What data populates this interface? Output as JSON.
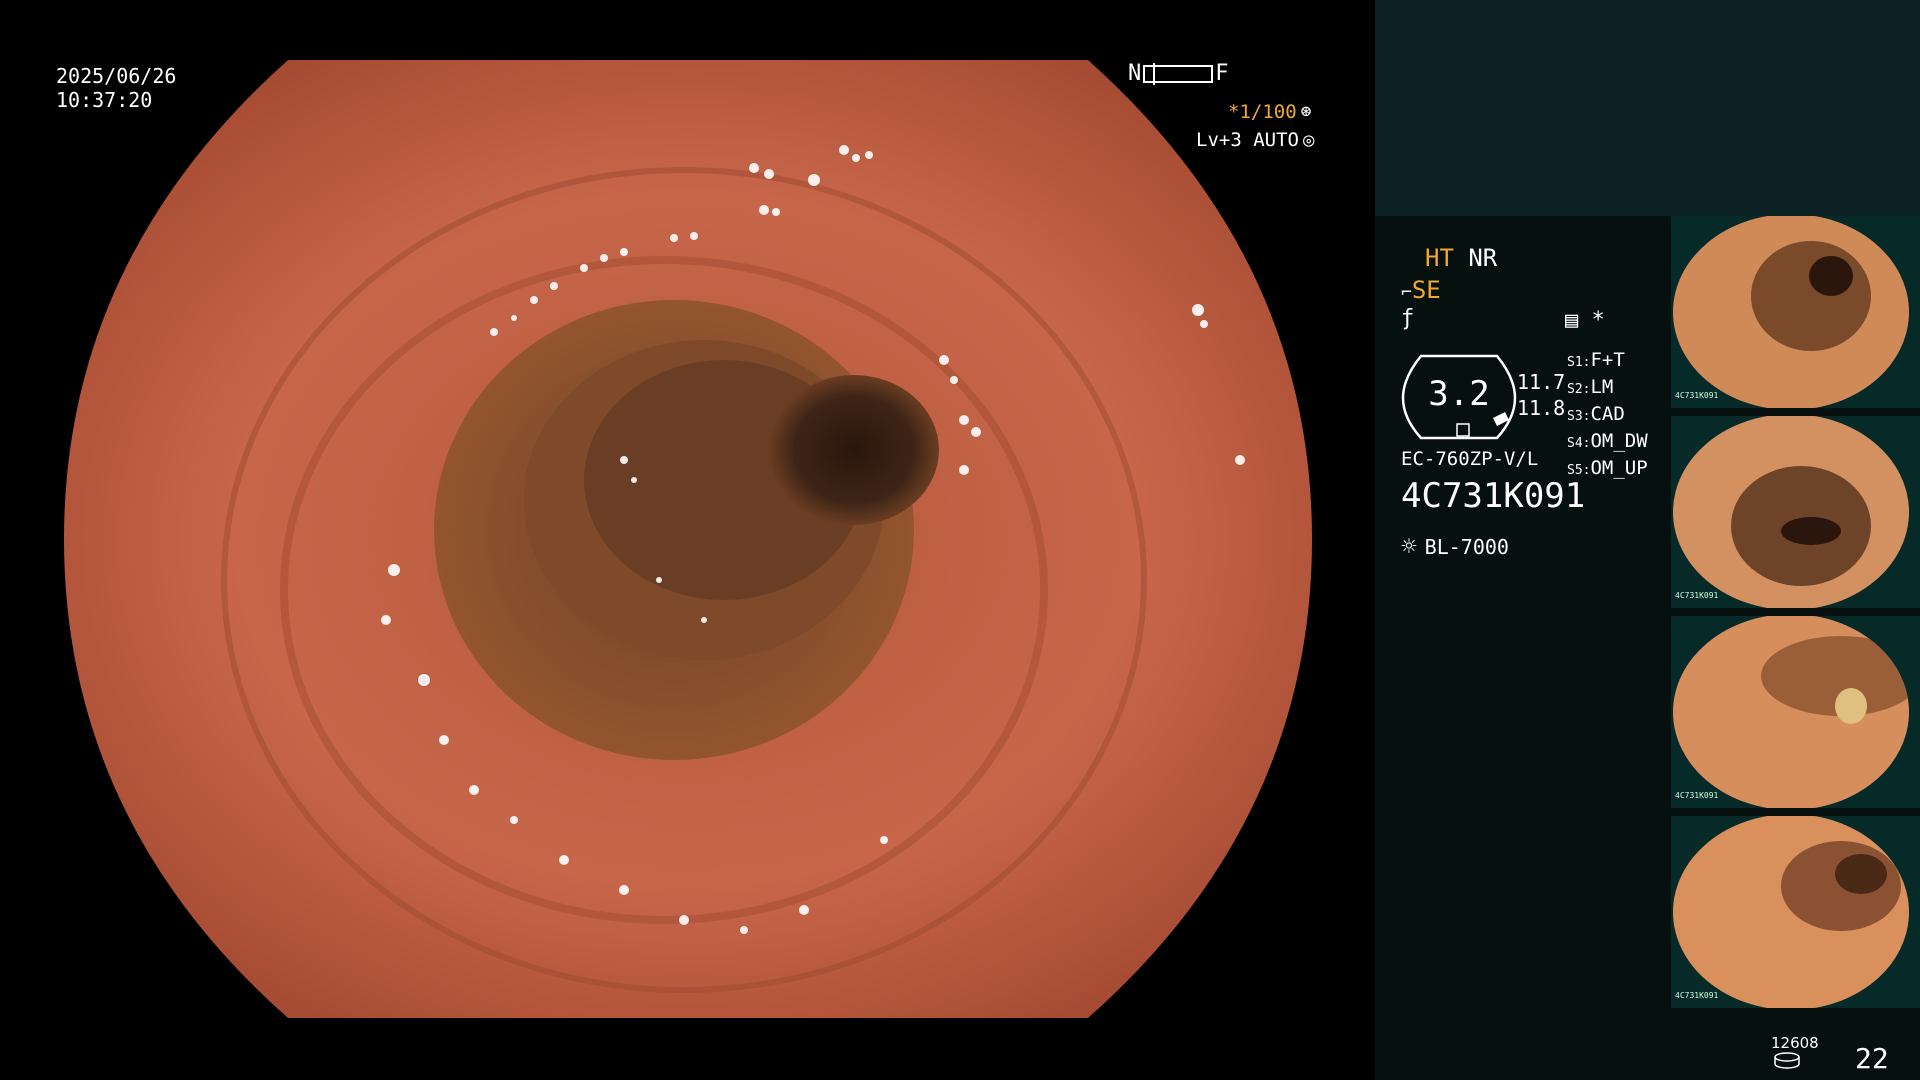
{
  "overlay": {
    "date": "2025/06/26",
    "time": "10:37:20",
    "nf_left": "N",
    "nf_right": "F",
    "shutter": "*1/100",
    "iris": "Lv+3 AUTO"
  },
  "panel": {
    "ht": "HT",
    "nr": "NR",
    "se": "SE",
    "badge_value": "3.2",
    "value_a": "11.7",
    "value_b": "11.8",
    "settings": [
      {
        "key": "S1:",
        "val": "F+T"
      },
      {
        "key": "S2:",
        "val": "LM"
      },
      {
        "key": "S3:",
        "val": "CAD"
      },
      {
        "key": "S4:",
        "val": "OM_DW"
      },
      {
        "key": "S5:",
        "val": "OM_UP"
      }
    ],
    "scope_model": "EC-760ZP-V/L",
    "serial": "4C731K091",
    "light_source": "BL-7000",
    "counter_small": "12608",
    "counter_big": "22",
    "thumbnail_id": "4C731K091"
  },
  "colors": {
    "mucosa": "#c8664a",
    "lumen": "#3a2418",
    "accent_orange": "#f0a830",
    "panel_bg": "#06100f",
    "panel_top": "#0c2224"
  }
}
